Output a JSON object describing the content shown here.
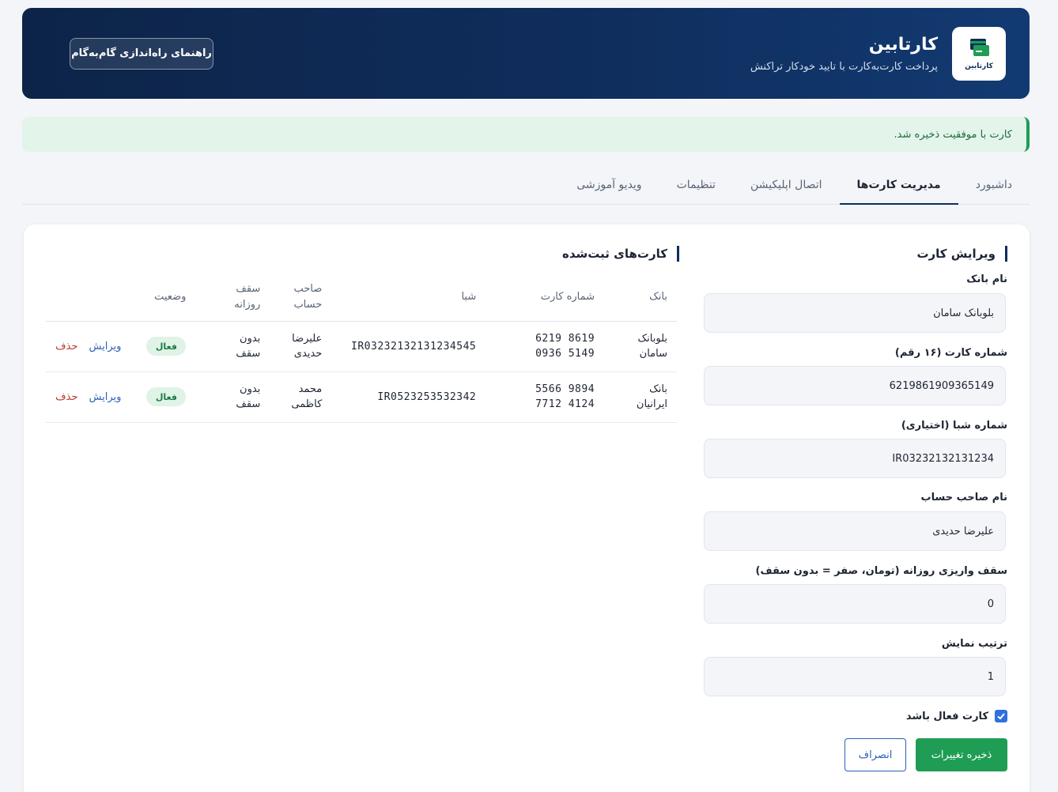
{
  "header": {
    "logo_text": "کارتابین",
    "title": "کارتابین",
    "subtitle": "پرداخت کارت‌به‌کارت با تایید خودکار تراکنش",
    "guide_button": "راهنمای راه‌اندازی گام‌به‌گام"
  },
  "alert": {
    "message": "کارت با موفقیت ذخیره شد."
  },
  "tabs": [
    {
      "label": "داشبورد",
      "active": false
    },
    {
      "label": "مدیریت کارت‌ها",
      "active": true
    },
    {
      "label": "اتصال اپلیکیشن",
      "active": false
    },
    {
      "label": "تنظیمات",
      "active": false
    },
    {
      "label": "ویدیو آموزشی",
      "active": false
    }
  ],
  "form": {
    "title": "ویرایش کارت",
    "bank_label": "نام بانک",
    "bank_value": "بلوبانک سامان",
    "card_label": "شماره کارت (۱۶ رقم)",
    "card_value": "6219861909365149",
    "sheba_label": "شماره شبا (اختیاری)",
    "sheba_value": "IR03232132131234",
    "holder_label": "نام صاحب حساب",
    "holder_value": "علیرضا حدیدی",
    "limit_label": "سقف واریزی روزانه (تومان، صفر = بدون سقف)",
    "limit_value": "0",
    "order_label": "ترتیب نمایش",
    "order_value": "1",
    "active_label": "کارت فعال باشد",
    "active_checked": true,
    "save_button": "ذخیره تغییرات",
    "cancel_button": "انصراف"
  },
  "table": {
    "title": "کارت‌های ثبت‌شده",
    "headers": {
      "bank": "بانک",
      "card": "شماره کارت",
      "sheba": "شبا",
      "holder": "صاحب حساب",
      "limit": "سقف روزانه",
      "status": "وضعیت"
    },
    "rows": [
      {
        "bank": "بلوبانک سامان",
        "card_line1": "6219 8619",
        "card_line2": "0936 5149",
        "sheba": "IR03232132131234545",
        "holder": "علیرضا حدیدی",
        "limit": "بدون سقف",
        "status": "فعال",
        "edit": "ویرایش",
        "delete": "حذف"
      },
      {
        "bank": "بانک ایرانیان",
        "card_line1": "5566 9894",
        "card_line2": "7712 4124",
        "sheba": "IR0523253532342",
        "holder": "محمد کاظمی",
        "limit": "بدون سقف",
        "status": "فعال",
        "edit": "ویرایش",
        "delete": "حذف"
      }
    ]
  },
  "colors": {
    "header_bg": "#0f2d5c",
    "success": "#1f9d55",
    "link": "#2b5fb8",
    "danger": "#c0392b"
  }
}
